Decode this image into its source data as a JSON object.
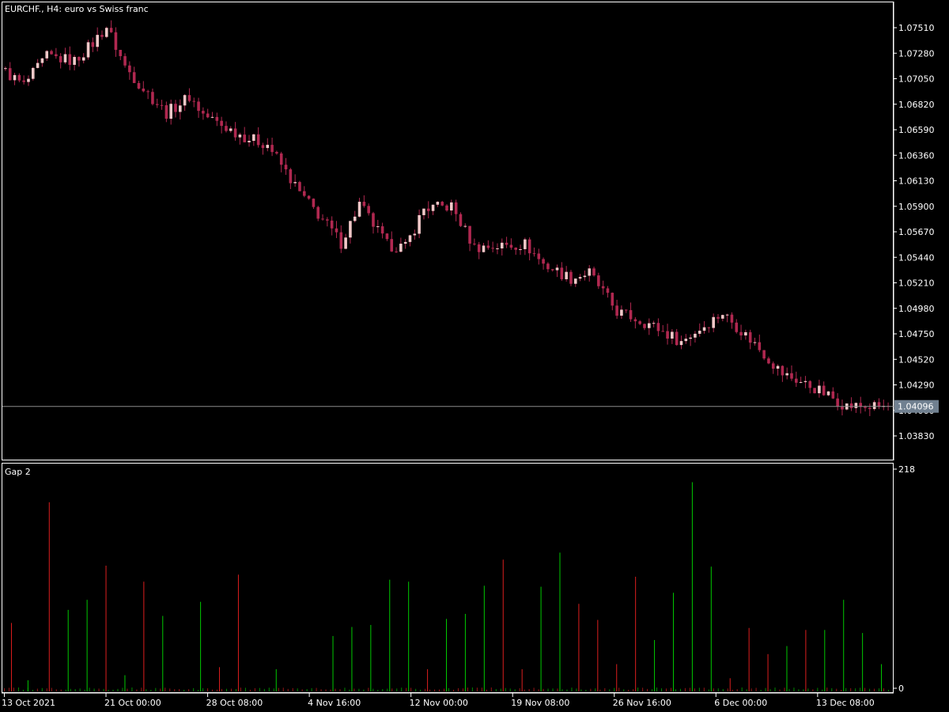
{
  "main_chart": {
    "symbol_label": "EURCHF., H4:  euro vs Swiss franc",
    "price_ticks": [
      "1.07510",
      "1.07280",
      "1.07050",
      "1.06820",
      "1.06590",
      "1.06360",
      "1.06130",
      "1.05900",
      "1.05670",
      "1.05440",
      "1.05210",
      "1.04980",
      "1.04750",
      "1.04520",
      "1.04290",
      "1.04060",
      "1.03830"
    ],
    "tick_values": [
      1.0751,
      1.0728,
      1.0705,
      1.0682,
      1.0659,
      1.0636,
      1.0613,
      1.059,
      1.0567,
      1.0544,
      1.0521,
      1.0498,
      1.0475,
      1.0452,
      1.0429,
      1.0406,
      1.0383
    ],
    "current_price": "1.04096",
    "current_price_value": 1.04096,
    "candle_count": 193,
    "colors": {
      "bull": "#f0c8c8",
      "bear": "#b02850",
      "wick": "#b02850",
      "price_line": "#8c8c8c",
      "price_box": "#708090"
    }
  },
  "indicator": {
    "label": "Gap 2",
    "scale_max": "218",
    "scale_min": "0",
    "range": [
      0,
      218
    ],
    "colors": {
      "up": "#00c800",
      "down": "#dc1e1e"
    },
    "bars": [
      {
        "i": 3,
        "v": 65,
        "c": "down"
      },
      {
        "i": 10,
        "v": 8,
        "c": "up"
      },
      {
        "i": 19,
        "v": 185,
        "c": "down"
      },
      {
        "i": 27,
        "v": 78,
        "c": "up"
      },
      {
        "i": 35,
        "v": 88,
        "c": "up"
      },
      {
        "i": 43,
        "v": 122,
        "c": "down"
      },
      {
        "i": 51,
        "v": 13,
        "c": "up"
      },
      {
        "i": 59,
        "v": 106,
        "c": "down"
      },
      {
        "i": 67,
        "v": 72,
        "c": "up"
      },
      {
        "i": 83,
        "v": 86,
        "c": "up"
      },
      {
        "i": 91,
        "v": 21,
        "c": "down"
      },
      {
        "i": 99,
        "v": 113,
        "c": "down"
      },
      {
        "i": 115,
        "v": 19,
        "c": "up"
      },
      {
        "i": 139,
        "v": 52,
        "c": "up"
      },
      {
        "i": 147,
        "v": 61,
        "c": "up"
      },
      {
        "i": 155,
        "v": 63,
        "c": "up"
      },
      {
        "i": 163,
        "v": 108,
        "c": "up"
      },
      {
        "i": 171,
        "v": 106,
        "c": "up"
      },
      {
        "i": 179,
        "v": 19,
        "c": "down"
      },
      {
        "i": 187,
        "v": 69,
        "c": "up"
      },
      {
        "i": 195,
        "v": 74,
        "c": "up"
      },
      {
        "i": 203,
        "v": 102,
        "c": "up"
      },
      {
        "i": 211,
        "v": 128,
        "c": "down"
      },
      {
        "i": 219,
        "v": 19,
        "c": "down"
      },
      {
        "i": 227,
        "v": 101,
        "c": "up"
      },
      {
        "i": 235,
        "v": 135,
        "c": "up"
      },
      {
        "i": 243,
        "v": 84,
        "c": "down"
      },
      {
        "i": 251,
        "v": 68,
        "c": "down"
      },
      {
        "i": 259,
        "v": 24,
        "c": "down"
      },
      {
        "i": 267,
        "v": 111,
        "c": "down"
      },
      {
        "i": 275,
        "v": 48,
        "c": "up"
      },
      {
        "i": 283,
        "v": 95,
        "c": "up"
      },
      {
        "i": 291,
        "v": 205,
        "c": "up"
      },
      {
        "i": 299,
        "v": 121,
        "c": "up"
      },
      {
        "i": 307,
        "v": 10,
        "c": "down"
      },
      {
        "i": 315,
        "v": 60,
        "c": "down"
      },
      {
        "i": 323,
        "v": 34,
        "c": "down"
      },
      {
        "i": 331,
        "v": 42,
        "c": "up"
      },
      {
        "i": 339,
        "v": 58,
        "c": "down"
      },
      {
        "i": 347,
        "v": 58,
        "c": "up"
      },
      {
        "i": 355,
        "v": 88,
        "c": "up"
      },
      {
        "i": 363,
        "v": 55,
        "c": "up"
      },
      {
        "i": 371,
        "v": 24,
        "c": "up"
      }
    ]
  },
  "time_axis": {
    "labels": [
      {
        "text": "13 Oct 2021",
        "i": 0
      },
      {
        "text": "21 Oct 00:00",
        "i": 43
      },
      {
        "text": "28 Oct 08:00",
        "i": 86
      },
      {
        "text": "4 Nov 16:00",
        "i": 129
      },
      {
        "text": "12 Nov 00:00",
        "i": 172
      },
      {
        "text": "19 Nov 08:00",
        "i": 215
      },
      {
        "text": "26 Nov 16:00",
        "i": 258
      },
      {
        "text": "6 Dec 00:00",
        "i": 301
      },
      {
        "text": "13 Dec 08:00",
        "i": 344
      }
    ]
  }
}
